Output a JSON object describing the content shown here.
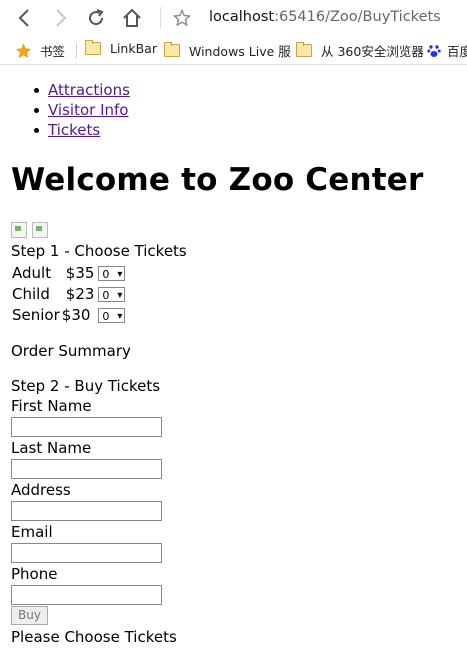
{
  "browser": {
    "address_host": "localhost",
    "address_path": ":65416/Zoo/BuyTickets",
    "bookmarks": [
      {
        "label": "书签"
      },
      {
        "label": "LinkBar"
      },
      {
        "label": "Windows Live 服"
      },
      {
        "label": "从 360安全浏览器"
      },
      {
        "label": "百度"
      }
    ]
  },
  "menu": [
    "Attractions",
    "Visitor Info",
    "Tickets"
  ],
  "title": "Welcome to Zoo Center",
  "step1": {
    "heading": "Step 1 - Choose Tickets",
    "tickets": [
      {
        "type": "Adult",
        "price": "$35",
        "qty": "0"
      },
      {
        "type": "Child",
        "price": "$23",
        "qty": "0"
      },
      {
        "type": "Senior",
        "price": "$30",
        "qty": "0"
      }
    ]
  },
  "summary": "Order Summary",
  "step2": {
    "heading": "Step 2 - Buy Tickets",
    "fields": [
      "First Name",
      "Last Name",
      "Address",
      "Email",
      "Phone"
    ],
    "buy_label": "Buy",
    "message": "Please Choose Tickets"
  }
}
